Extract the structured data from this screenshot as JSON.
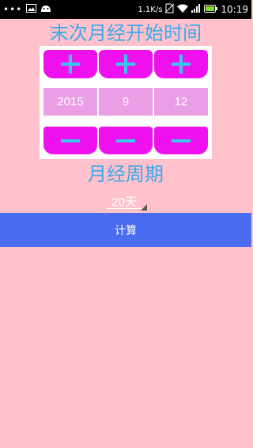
{
  "status_bar": {
    "dots": "•••",
    "speed": "1.1K/s",
    "time": "10:19",
    "icons": [
      "image-icon",
      "android-icon",
      "no-sim-icon",
      "wifi-icon",
      "signal-icon",
      "battery-icon"
    ]
  },
  "title": "末次月经开始时间",
  "date_picker": {
    "year": "2015",
    "month": "9",
    "day": "12"
  },
  "cycle_label": "月经周期",
  "cycle_select": {
    "value": "20天"
  },
  "calculate_button": "计算",
  "colors": {
    "background": "#ffc1cb",
    "title": "#3aaae8",
    "stepper_button": "#ee11ee",
    "stepper_symbol": "#3cc5ee",
    "value_box": "#e99ee6",
    "calculate_button": "#4a6cf0"
  }
}
